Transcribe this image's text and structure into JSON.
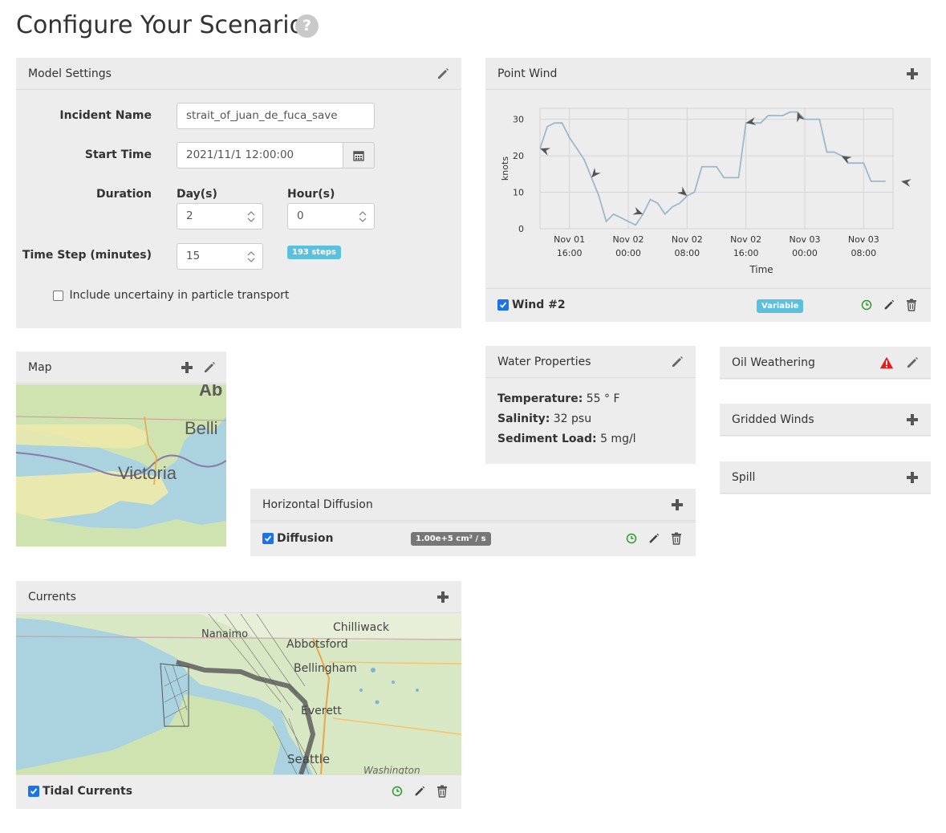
{
  "page": {
    "title": "Configure Your Scenario",
    "help_icon": "question-circle-icon"
  },
  "model_settings": {
    "title": "Model Settings",
    "incident_name_label": "Incident Name",
    "incident_name_value": "strait_of_juan_de_fuca_save",
    "start_time_label": "Start Time",
    "start_time_value": "2021/11/1 12:00:00",
    "duration_label": "Duration",
    "days_label": "Day(s)",
    "days_value": "2",
    "hours_label": "Hour(s)",
    "hours_value": "0",
    "time_step_label": "Time Step (minutes)",
    "time_step_value": "15",
    "steps_badge": "193 steps",
    "uncertainty_label": "Include uncertainy in particle transport",
    "uncertainty_checked": false
  },
  "point_wind": {
    "title": "Point Wind",
    "item_name": "Wind #2",
    "item_checked": true,
    "badge": "Variable",
    "badge_color": "#5bc0de"
  },
  "map": {
    "title": "Map",
    "labels": [
      "Ab",
      "Belli",
      "Victoria"
    ]
  },
  "water_properties": {
    "title": "Water Properties",
    "temperature_label": "Temperature:",
    "temperature_value": "55 ° F",
    "salinity_label": "Salinity:",
    "salinity_value": "32 psu",
    "sediment_label": "Sediment Load:",
    "sediment_value": "5 mg/l"
  },
  "oil_weathering": {
    "title": "Oil Weathering",
    "warning_color": "#e02020"
  },
  "gridded_winds": {
    "title": "Gridded Winds"
  },
  "spill": {
    "title": "Spill"
  },
  "horizontal_diffusion": {
    "title": "Horizontal Diffusion",
    "item_name": "Diffusion",
    "item_checked": true,
    "badge": "1.00e+5 cm² / s",
    "badge_color": "#777777"
  },
  "currents": {
    "title": "Currents",
    "item_name": "Tidal Currents",
    "item_checked": true,
    "map_labels": [
      "Chilliwack",
      "Nanaimo",
      "Abbotsford",
      "Bellingham",
      "Everett",
      "Seattle",
      "Washington"
    ]
  },
  "chart_data": {
    "type": "line",
    "xlabel": "Time",
    "ylabel": "knots",
    "ylim": [
      0,
      33
    ],
    "yticks": [
      0,
      10,
      20,
      30
    ],
    "xtick_labels": [
      {
        "line1": "Nov 01",
        "line2": "16:00",
        "hours": 4
      },
      {
        "line1": "Nov 02",
        "line2": "00:00",
        "hours": 12
      },
      {
        "line1": "Nov 02",
        "line2": "08:00",
        "hours": 20
      },
      {
        "line1": "Nov 02",
        "line2": "16:00",
        "hours": 28
      },
      {
        "line1": "Nov 03",
        "line2": "00:00",
        "hours": 36
      },
      {
        "line1": "Nov 03",
        "line2": "08:00",
        "hours": 44
      }
    ],
    "xlim_hours": [
      0,
      48
    ],
    "grid": true,
    "series": [
      {
        "color": "#9ab9cc",
        "x_hours": [
          0,
          1,
          2,
          3,
          4,
          5,
          6,
          7,
          8,
          9,
          10,
          11,
          12,
          13,
          14,
          15,
          16,
          17,
          18,
          19,
          20,
          21,
          22,
          23,
          24,
          25,
          26,
          27,
          28,
          29,
          30,
          31,
          32,
          33,
          34,
          35,
          36,
          37,
          38,
          39,
          40,
          41,
          42,
          43,
          44,
          45,
          46,
          47
        ],
        "values": [
          22,
          28,
          29,
          29,
          25,
          22,
          19,
          14,
          9,
          2,
          4,
          3,
          2,
          1,
          4,
          8,
          7,
          4,
          6,
          7,
          9,
          10,
          17,
          17,
          17,
          14,
          14,
          14,
          29,
          29,
          29,
          31,
          31,
          31,
          32,
          32,
          30,
          30,
          30,
          21,
          21,
          20,
          18,
          18,
          18,
          13,
          13,
          13
        ]
      }
    ],
    "arrow_hours": [
      0,
      7,
      14,
      20,
      28,
      35,
      41,
      48
    ]
  }
}
